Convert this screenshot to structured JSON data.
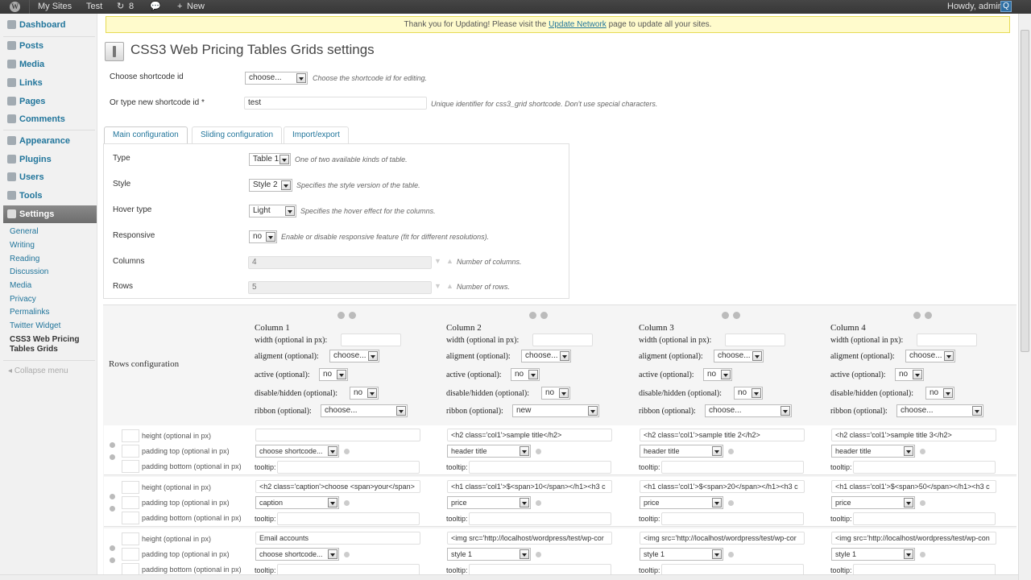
{
  "adminbar": {
    "my_sites": "My Sites",
    "site": "Test",
    "updates_count": "8",
    "new": "New",
    "howdy": "Howdy, admin"
  },
  "sidebar": {
    "items": [
      "Dashboard",
      "Posts",
      "Media",
      "Links",
      "Pages",
      "Comments",
      "Appearance",
      "Plugins",
      "Users",
      "Tools",
      "Settings"
    ],
    "submenu": [
      "General",
      "Writing",
      "Reading",
      "Discussion",
      "Media",
      "Privacy",
      "Permalinks",
      "Twitter Widget",
      "CSS3 Web Pricing Tables Grids"
    ],
    "collapse": "Collapse menu"
  },
  "notice": {
    "before": "Thank you for Updating! Please visit the ",
    "link": "Update Network",
    "after": " page to update all your sites."
  },
  "page": {
    "title": "CSS3 Web Pricing Tables Grids settings",
    "shortcode_label": "Choose shortcode id",
    "shortcode_value": "choose...",
    "shortcode_desc": "Choose the shortcode id for editing.",
    "newid_label": "Or type new shortcode id *",
    "newid_value": "test",
    "newid_desc": "Unique identifier for css3_grid shortcode. Don't use special characters."
  },
  "tabs": [
    "Main configuration",
    "Sliding configuration",
    "Import/export"
  ],
  "main": {
    "type_label": "Type",
    "type_value": "Table 1",
    "type_desc": "One of two available kinds of table.",
    "style_label": "Style",
    "style_value": "Style 2",
    "style_desc": "Specifies the style version of the table.",
    "hover_label": "Hover type",
    "hover_value": "Light",
    "hover_desc": "Specifies the hover effect for the columns.",
    "resp_label": "Responsive",
    "resp_value": "no",
    "resp_desc": "Enable or disable responsive feature (fit for different resolutions).",
    "cols_label": "Columns",
    "cols_value": "4",
    "cols_desc": "Number of columns.",
    "rows_label": "Rows",
    "rows_value": "5",
    "rows_desc": "Number of rows."
  },
  "rows_config": {
    "label": "Rows configuration",
    "width_label": "width (optional in px):",
    "align_label": "aligment (optional):",
    "active_label": "active (optional):",
    "hidden_label": "disable/hidden (optional):",
    "ribbon_label": "ribbon (optional):",
    "columns": [
      {
        "name": "Column 1",
        "align": "choose...",
        "active": "no",
        "hidden": "no",
        "ribbon": "choose..."
      },
      {
        "name": "Column 2",
        "align": "choose...",
        "active": "no",
        "hidden": "no",
        "ribbon": "new"
      },
      {
        "name": "Column 3",
        "align": "choose...",
        "active": "no",
        "hidden": "no",
        "ribbon": "choose..."
      },
      {
        "name": "Column 4",
        "align": "choose...",
        "active": "no",
        "hidden": "no",
        "ribbon": "choose..."
      }
    ]
  },
  "row_labels": {
    "height": "height (optional in px)",
    "padding_top": "padding top (optional in px)",
    "padding_bottom": "padding bottom (optional in px)",
    "tooltip": "tooltip:"
  },
  "rows": [
    {
      "cells": [
        {
          "content": "",
          "type": "choose shortcode..."
        },
        {
          "content": "<h2 class='col1'>sample title</h2>",
          "type": "header title"
        },
        {
          "content": "<h2 class='col1'>sample title 2</h2>",
          "type": "header title"
        },
        {
          "content": "<h2 class='col1'>sample title 3</h2>",
          "type": "header title"
        }
      ]
    },
    {
      "cells": [
        {
          "content": "<h2 class='caption'>choose <span>your</span>",
          "type": "caption"
        },
        {
          "content": "<h1 class='col1'>$<span>10</span></h1><h3 c",
          "type": "price"
        },
        {
          "content": "<h1 class='col1'>$<span>20</span></h1><h3 c",
          "type": "price"
        },
        {
          "content": "<h1 class='col1'>$<span>50</span></h1><h3 c",
          "type": "price"
        }
      ]
    },
    {
      "cells": [
        {
          "content": "Email accounts",
          "type": "choose shortcode..."
        },
        {
          "content": "<img src='http://localhost/wordpress/test/wp-cor",
          "type": "style 1"
        },
        {
          "content": "<img src='http://localhost/wordpress/test/wp-cor",
          "type": "style 1"
        },
        {
          "content": "<img src='http://localhost/wordpress/test/wp-con",
          "type": "style 1"
        }
      ]
    }
  ]
}
